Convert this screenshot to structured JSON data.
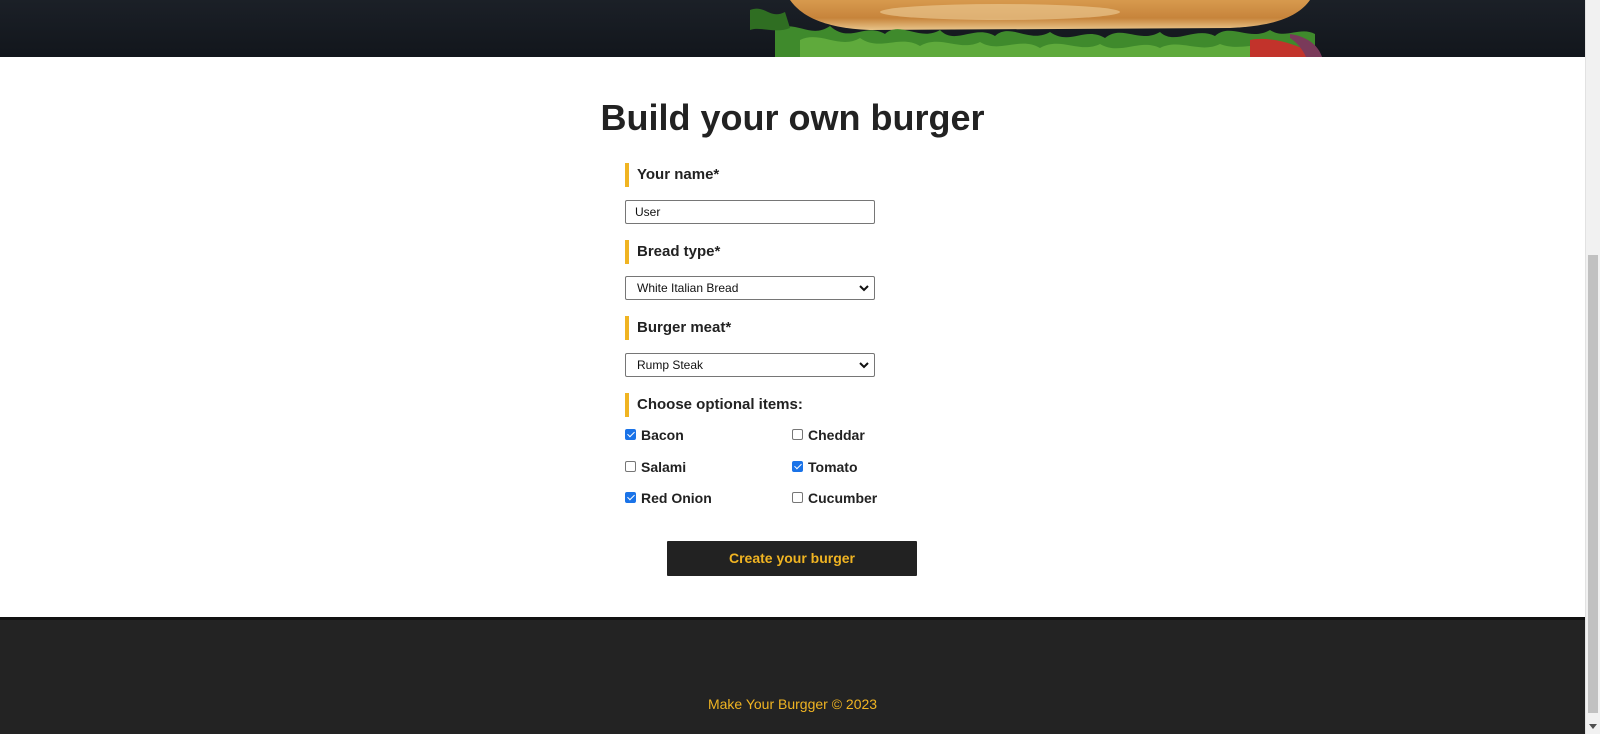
{
  "page": {
    "title": "Build your own burger"
  },
  "form": {
    "name_label": "Your name*",
    "name_value": "User",
    "bread_label": "Bread type*",
    "bread_selected": "White Italian Bread",
    "meat_label": "Burger meat*",
    "meat_selected": "Rump Steak",
    "optional_label": "Choose optional items:",
    "optional_items": [
      {
        "label": "Bacon",
        "checked": true
      },
      {
        "label": "Cheddar",
        "checked": false
      },
      {
        "label": "Salami",
        "checked": false
      },
      {
        "label": "Tomato",
        "checked": true
      },
      {
        "label": "Red Onion",
        "checked": true
      },
      {
        "label": "Cucumber",
        "checked": false
      }
    ],
    "submit_label": "Create your burger"
  },
  "footer": {
    "text": "Make Your Burgger © 2023"
  },
  "colors": {
    "accent": "#f0b422",
    "dark": "#222222",
    "checkbox_checked": "#1a73e8"
  },
  "icons": {
    "select_chevron": "chevron-down-icon",
    "scroll_down": "scroll-down-arrow-icon"
  }
}
